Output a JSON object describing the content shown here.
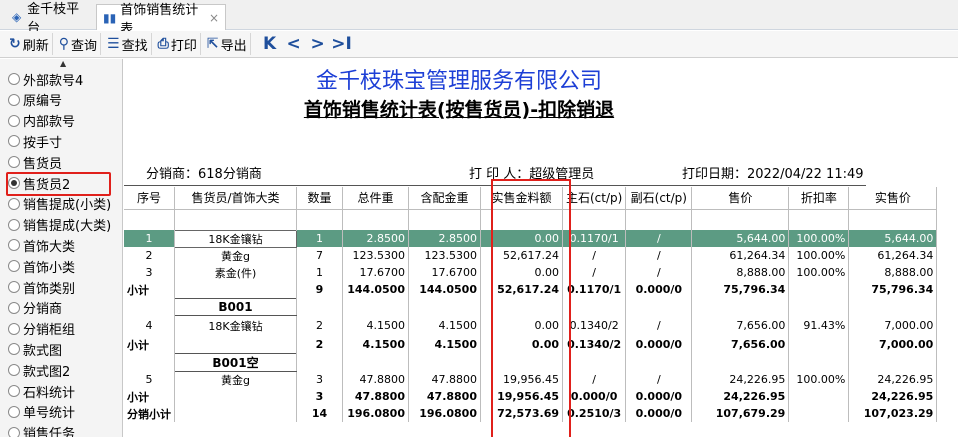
{
  "tabs": [
    {
      "label": "金千枝平台",
      "icon": "platform-icon"
    },
    {
      "label": "首饰销售统计表",
      "icon": "chart-icon",
      "close": "×"
    }
  ],
  "toolbar": {
    "refresh": "刷新",
    "query": "查询",
    "find": "查找",
    "print": "打印",
    "export": "导出",
    "nav": [
      "K",
      "<",
      ">",
      ">I"
    ]
  },
  "sidebar": {
    "options": [
      "外部款号4",
      "原编号",
      "内部款号",
      "按手寸",
      "售货员",
      "售货员2",
      "销售提成(小类)",
      "销售提成(大类)",
      "首饰大类",
      "首饰小类",
      "首饰类别",
      "分销商",
      "分销柜组",
      "款式图",
      "款式图2",
      "石料统计",
      "单号统计",
      "销售任务"
    ],
    "selected_index": 5
  },
  "report": {
    "company": "金千枝珠宝管理服务有限公司",
    "title": "首饰销售统计表(按售货员)-扣除销退",
    "distributor": "分销商：618分销商",
    "printer": "打 印 人：超级管理员",
    "print_date": "打印日期：2022/04/22 11:49",
    "columns": [
      "序号",
      "售货员/首饰大类",
      "数量",
      "总件重",
      "含配金重",
      "实售金料额",
      "主石(ct/p)",
      "副石(ct/p)",
      "售价",
      "折扣率",
      "实售价"
    ],
    "rows": [
      {
        "type": "blank"
      },
      {
        "type": "data",
        "sel": true,
        "cells": [
          "1",
          "18K金镶钻",
          "1",
          "2.8500",
          "2.8500",
          "0.00",
          "0.1170/1",
          "/",
          "5,644.00",
          "100.00%",
          "5,644.00"
        ]
      },
      {
        "type": "data",
        "cells": [
          "2",
          "黄金g",
          "7",
          "123.5300",
          "123.5300",
          "52,617.24",
          "/",
          "/",
          "61,264.34",
          "100.00%",
          "61,264.34"
        ]
      },
      {
        "type": "data",
        "cells": [
          "3",
          "素金(件)",
          "1",
          "17.6700",
          "17.6700",
          "0.00",
          "/",
          "/",
          "8,888.00",
          "100.00%",
          "8,888.00"
        ]
      },
      {
        "type": "sub",
        "cells": [
          "小计",
          "",
          "9",
          "144.0500",
          "144.0500",
          "52,617.24",
          "0.1170/1",
          "0.000/0",
          "75,796.34",
          "",
          "75,796.34"
        ]
      },
      {
        "type": "group",
        "label": "B001"
      },
      {
        "type": "data",
        "tall": true,
        "cells": [
          "4",
          "18K金镶钻",
          "2",
          "4.1500",
          "4.1500",
          "0.00",
          "0.1340/2",
          "/",
          "7,656.00",
          "91.43%",
          "7,000.00"
        ]
      },
      {
        "type": "sub",
        "cells": [
          "小计",
          "",
          "2",
          "4.1500",
          "4.1500",
          "0.00",
          "0.1340/2",
          "0.000/0",
          "7,656.00",
          "",
          "7,000.00"
        ]
      },
      {
        "type": "group",
        "label": "B001空"
      },
      {
        "type": "data",
        "cells": [
          "5",
          "黄金g",
          "3",
          "47.8800",
          "47.8800",
          "19,956.45",
          "/",
          "/",
          "24,226.95",
          "100.00%",
          "24,226.95"
        ]
      },
      {
        "type": "sub",
        "cells": [
          "小计",
          "",
          "3",
          "47.8800",
          "47.8800",
          "19,956.45",
          "0.000/0",
          "0.000/0",
          "24,226.95",
          "",
          "24,226.95"
        ]
      },
      {
        "type": "sub",
        "cells": [
          "分销小计",
          "",
          "14",
          "196.0800",
          "196.0800",
          "72,573.69",
          "0.2510/3",
          "0.000/0",
          "107,679.29",
          "",
          "107,023.29"
        ]
      }
    ]
  }
}
